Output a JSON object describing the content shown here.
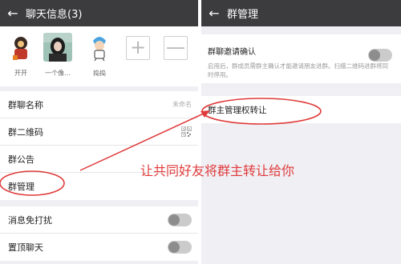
{
  "left_panel": {
    "title": "聊天信息(3)",
    "members": [
      {
        "name": "开开"
      },
      {
        "name": "一个像..."
      },
      {
        "name": "捣捣"
      }
    ],
    "add_symbol": "+",
    "remove_symbol": "—",
    "rows": {
      "group_name_label": "群聊名称",
      "group_name_value": "未命名",
      "qr_label": "群二维码",
      "notice_label": "群公告",
      "manage_label": "群管理",
      "mute_label": "消息免打扰",
      "pin_label": "置顶聊天"
    }
  },
  "right_panel": {
    "title": "群管理",
    "invite_confirm_label": "群聊邀请确认",
    "invite_confirm_desc": "启用后，群成员需群主确认才能邀请朋友进群。扫描二维码进群将同时停用。",
    "transfer_label": "群主管理权转让"
  },
  "annotation": {
    "caption": "让共同好友将群主转让给你",
    "color": "#e03a3a"
  },
  "icons": {
    "back": "back-arrow-icon",
    "qr": "qr-code-icon"
  },
  "toggles": {
    "mute": false,
    "pin": false,
    "invite_confirm": false
  }
}
